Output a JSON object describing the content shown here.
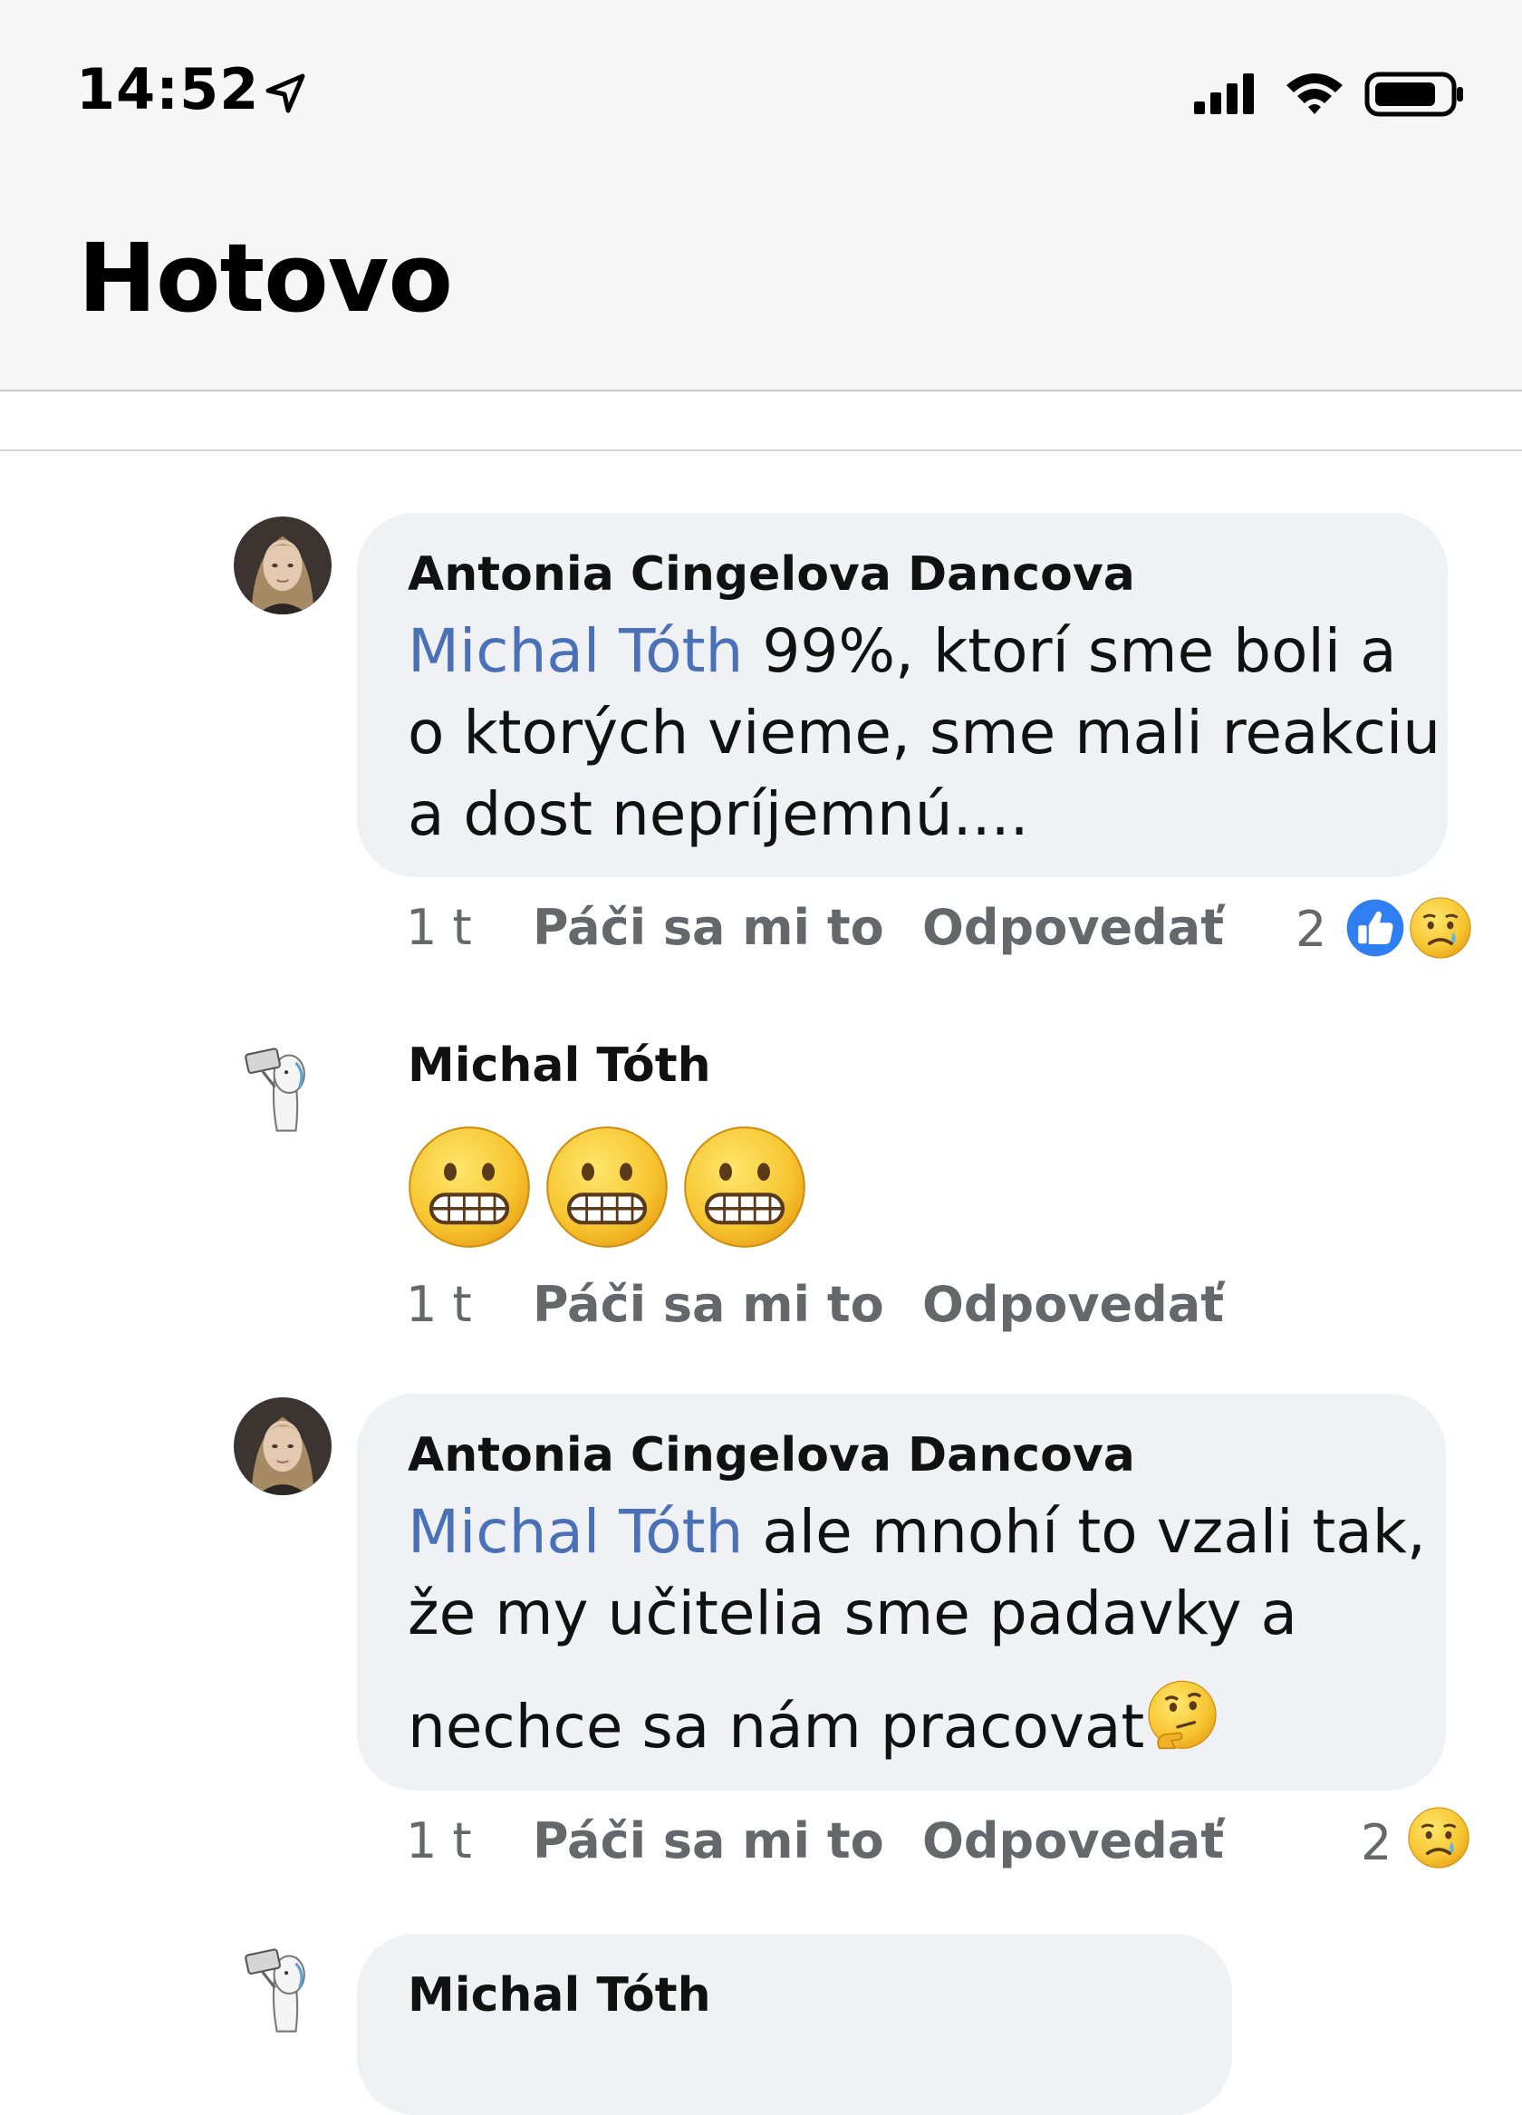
{
  "status_bar": {
    "time": "14:52",
    "icons": [
      "location-arrow-icon",
      "cellular-signal-icon",
      "wifi-icon",
      "battery-icon"
    ]
  },
  "header": {
    "title": "Hotovo"
  },
  "colors": {
    "mention": "#4a70b8",
    "bubble": "#eff1f4",
    "meta_text": "#65676b",
    "like_blue": "#2f7ff2"
  },
  "comments": [
    {
      "author": "Antonia Cingelova Dancova",
      "mention": "Michal Tóth",
      "lines": [
        " 99%, ktorí sme boli a",
        "o ktorých vieme, sme mali reakciu",
        "a dost nepríjemnú...."
      ],
      "time": "1 t",
      "like_label": "Páči sa mi to",
      "reply_label": "Odpovedať",
      "reaction_count": "2",
      "reactions": [
        "like-icon",
        "sad-icon"
      ]
    },
    {
      "author": "Michal Tóth",
      "emojis": [
        "grimacing-face-icon",
        "grimacing-face-icon",
        "grimacing-face-icon"
      ],
      "time": "1 t",
      "like_label": "Páči sa mi to",
      "reply_label": "Odpovedať"
    },
    {
      "author": "Antonia Cingelova Dancova",
      "mention": "Michal Tóth",
      "lines": [
        " ale mnohí to vzali tak,",
        "že my učitelia sme padavky a",
        "nechce sa nám pracovat"
      ],
      "trailing_emoji": "thinking-face-icon",
      "time": "1 t",
      "like_label": "Páči sa mi to",
      "reply_label": "Odpovedať",
      "reaction_count": "2",
      "reactions": [
        "sad-icon"
      ]
    },
    {
      "author": "Michal Tóth"
    }
  ]
}
